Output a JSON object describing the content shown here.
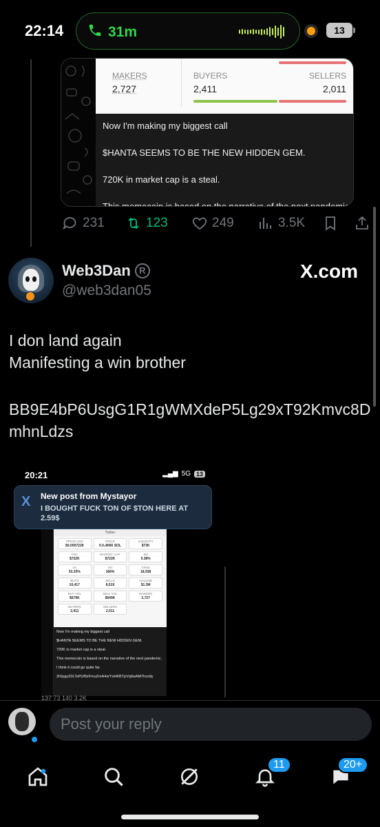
{
  "status_bar": {
    "time": "22:14",
    "call_duration": "31m",
    "battery": "13"
  },
  "previous_tweet": {
    "card": {
      "makers_label": "MAKERS",
      "makers_value": "2,727",
      "buyers_label": "BUYERS",
      "buyers_value": "2,411",
      "sellers_label": "SELLERS",
      "sellers_value": "2,011",
      "lines": [
        "Now I'm making my biggest call",
        "$HANTA SEEMS TO BE THE NEW HIDDEN GEM.",
        "720K in market cap is a steal.",
        "This memecoin is based on the narrative of the next pandemic."
      ]
    },
    "actions": {
      "replies": "231",
      "reposts": "123",
      "likes": "249",
      "views": "3.5K"
    }
  },
  "tweet": {
    "display_name": "Web3Dan",
    "registered_mark": "R",
    "handle": "@web3dan05",
    "site_label": "X.com",
    "text_line1": "I don land again",
    "text_line2": "Manifesting a win brother",
    "address": "BB9E4bP6UsgG1R1gWMXdeP5Lg29xT92Kmvc8DmhnLdzs"
  },
  "embedded_screenshot": {
    "time": "20:21",
    "network": "5G",
    "battery": "13",
    "notification_title": "New post from Mystayor",
    "notification_body": "I BOUGHT FUCK TON OF $TON HERE AT 2.59$",
    "card_header": "Twitter",
    "card_stats": [
      {
        "label": "PRICE USD",
        "value": "$0.0007228"
      },
      {
        "label": "PRICE",
        "value": "0.0₅8066 SOL"
      },
      {
        "label": "LIQUIDITY",
        "value": "$73K"
      },
      {
        "label": "FDV",
        "value": "$722K"
      },
      {
        "label": "MARKET CAP",
        "value": "$722K"
      },
      {
        "label": "5M",
        "value": "0.38%"
      },
      {
        "label": "1H",
        "value": "53.35%"
      },
      {
        "label": "6H",
        "value": "166%"
      },
      {
        "label": "TXNS",
        "value": "18,938"
      },
      {
        "label": "BUYS",
        "value": "10,417"
      },
      {
        "label": "SELLS",
        "value": "8,519"
      },
      {
        "label": "VOLUME",
        "value": "$1.3M"
      },
      {
        "label": "BUY VOL",
        "value": "$679K"
      },
      {
        "label": "SELL VOL",
        "value": "$649K"
      },
      {
        "label": "MAKERS",
        "value": "2,727"
      },
      {
        "label": "BUYERS",
        "value": "2,411"
      },
      {
        "label": "SELLERS",
        "value": "2,011"
      }
    ],
    "lines": [
      "Now I'm making my biggest call",
      "$HANTA SEEMS TO BE THE NEW HIDDEN GEM.",
      "720K in market cap is a steal.",
      "This memecoin is based on the narrative of the next pandemic.",
      "I think it could go quite far.",
      "2tXpgu20LTsPUf9zFmuZmA4xrYxHKBTpVq9wAM7hzs9y"
    ],
    "actions": "137   73   140   3.2K"
  },
  "reply": {
    "placeholder": "Post your reply"
  },
  "nav": {
    "notifications_badge": "11",
    "messages_badge": "20+"
  },
  "colors": {
    "accent": "#1d9bf0",
    "repost_green": "#00ba7c",
    "call_green": "#32d74b"
  }
}
